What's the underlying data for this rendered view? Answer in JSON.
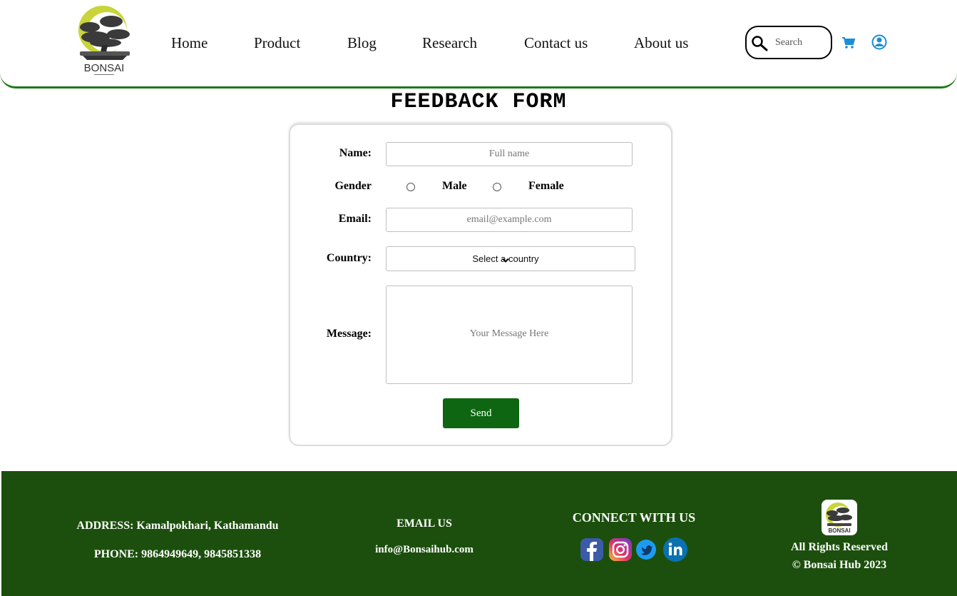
{
  "header": {
    "logo_text": "BONSAI",
    "nav": [
      "Home",
      "Product",
      "Blog",
      "Research",
      "Contact us",
      "About us"
    ],
    "search_placeholder": "Search",
    "icons": [
      "search-icon",
      "cart-icon",
      "user-icon"
    ]
  },
  "form": {
    "title": "FEEDBACK FORM",
    "name_label": "Name:",
    "name_placeholder": "Full name",
    "gender_label": "Gender",
    "gender_options": [
      "Male",
      "Female"
    ],
    "email_label": "Email:",
    "email_placeholder": "email@example.com",
    "country_label": "Country:",
    "country_selected": "Select a country",
    "message_label": "Message:",
    "message_placeholder": "Your Message Here",
    "send_label": "Send"
  },
  "footer": {
    "address": "ADDRESS: Kamalpokhari, Kathamandu",
    "phone": "PHONE: 9864949649, 9845851338",
    "email_heading": "EMAIL US",
    "email": "info@Bonsaihub.com",
    "connect_heading": "CONNECT WITH US",
    "social": [
      "facebook-icon",
      "instagram-icon",
      "twitter-icon",
      "linkedin-icon"
    ],
    "rights": "All Rights Reserved",
    "copyright": "© Bonsai Hub 2023"
  },
  "colors": {
    "accent_green": "#1c7a16",
    "footer_bg": "#1c4f0d",
    "button_bg": "#0e6612",
    "icon_blue": "#1a8ed6"
  }
}
